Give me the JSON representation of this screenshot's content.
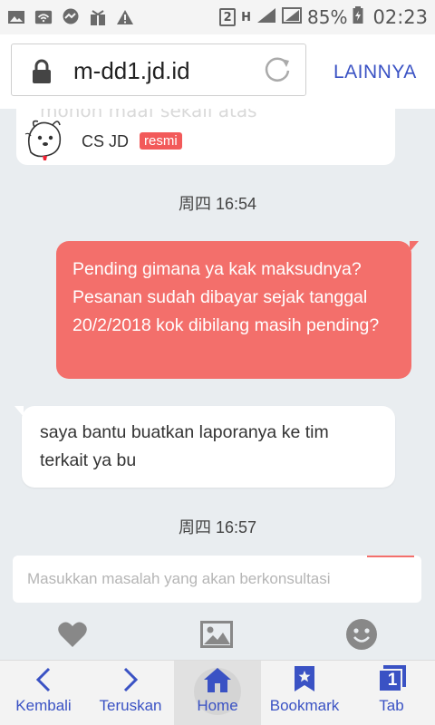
{
  "status_bar": {
    "sim_slot": "2",
    "network": "H",
    "battery_percent": "85%",
    "time": "02:23",
    "icons": [
      "image-icon",
      "wifi-icon",
      "messenger-icon",
      "gift-icon",
      "warning-icon"
    ]
  },
  "browser": {
    "url": "m-dd1.jd.id",
    "menu_label": "LAINNYA"
  },
  "agent": {
    "name": "CS JD",
    "badge": "resmi",
    "partial_text": "mohon maaf sekali atas"
  },
  "chat": {
    "messages": [
      {
        "timestamp": "周四 16:54",
        "from": "user",
        "text": "Pending gimana ya kak maksudnya? Pesanan sudah dibayar sejak tanggal 20/2/2018 kok dibilang masih pending?"
      },
      {
        "from": "agent",
        "text": "saya bantu buatkan laporanya ke tim terkait ya bu"
      },
      {
        "timestamp": "周四 16:57"
      }
    ],
    "input_placeholder": "Masukkan masalah yang akan berkonsultasi",
    "tools": [
      "heart-icon",
      "image-icon",
      "emoji-icon"
    ]
  },
  "bottom_nav": {
    "items": [
      {
        "label": "Kembali",
        "icon": "back-icon"
      },
      {
        "label": "Teruskan",
        "icon": "forward-icon"
      },
      {
        "label": "Home",
        "icon": "home-icon",
        "active": true
      },
      {
        "label": "Bookmark",
        "icon": "bookmark-icon"
      },
      {
        "label": "Tab",
        "icon": "tabs-icon",
        "count": "1"
      }
    ]
  },
  "colors": {
    "accent": "#f36f6b",
    "link": "#3a52c4",
    "background": "#e9edf0"
  }
}
